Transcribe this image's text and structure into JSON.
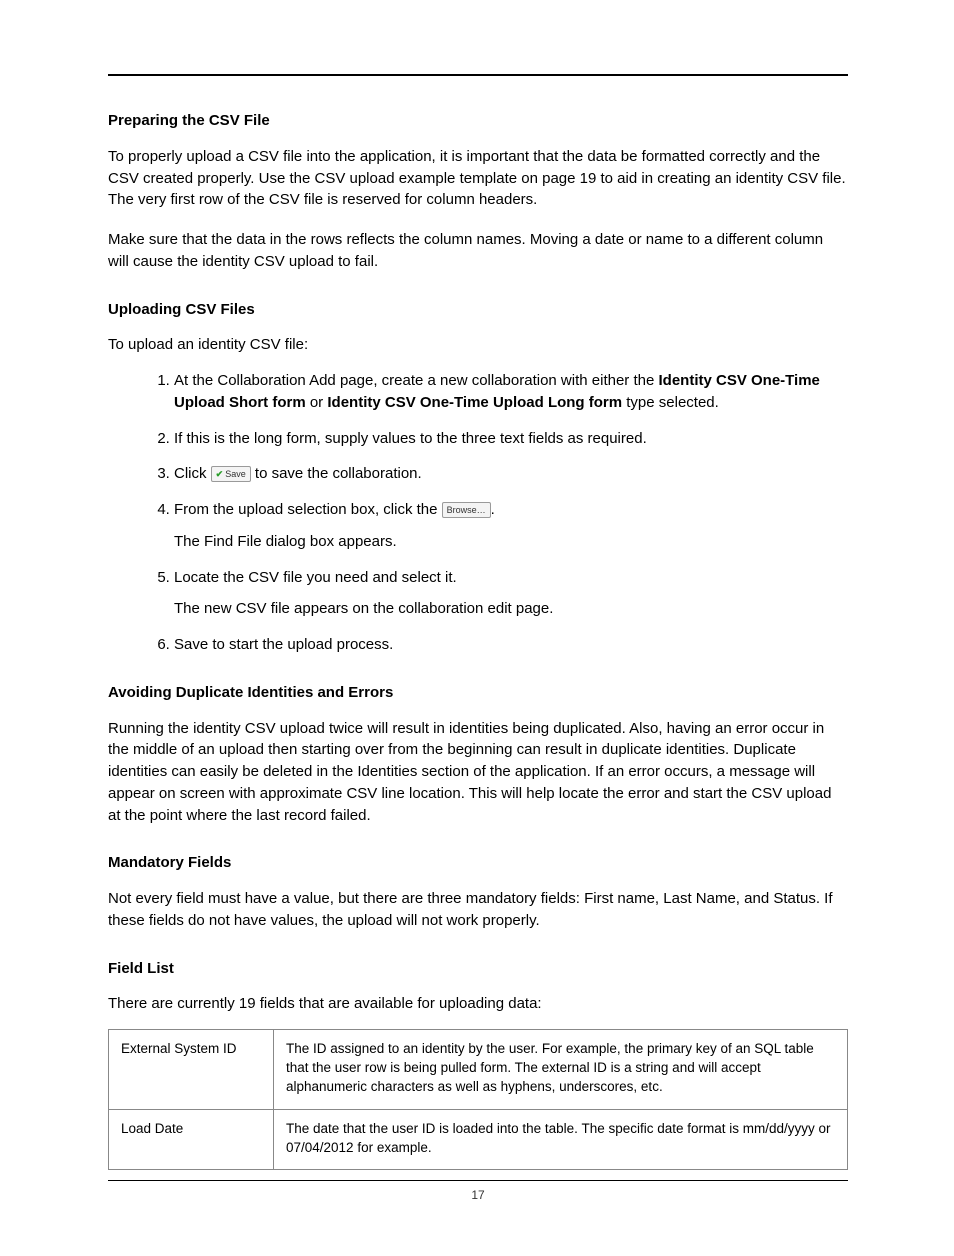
{
  "page_number": "17",
  "sections": {
    "preparing": {
      "heading": "Preparing the CSV File",
      "p1": "To properly upload a CSV file into the application, it is important that the data be formatted correctly and the CSV created properly. Use the CSV upload example template on page 19 to aid in creating an identity CSV file. The very first row of the CSV file is reserved for column headers.",
      "p2": "Make sure that the data in the rows reflects the column names. Moving a date or name to a different column will cause the identity CSV upload to fail."
    },
    "uploading": {
      "heading": "Uploading CSV Files",
      "lead": "To upload an identity CSV file:",
      "steps": {
        "s1_a": "At the Collaboration Add page, create a new collaboration with either the ",
        "s1_bold1": "Identity CSV One-Time Upload Short form",
        "s1_b": " or ",
        "s1_bold2": "Identity CSV One-Time Upload Long form",
        "s1_c": " type selected.",
        "s2": "If this is the long form, supply values to the three text fields as required.",
        "s3_a": "Click ",
        "s3_save_label": "Save",
        "s3_b": " to save the collaboration.",
        "s4_a": "From the upload selection box, click the ",
        "s4_browse_label": "Browse…",
        "s4_b": ".",
        "s4_sub": "The Find File dialog box appears.",
        "s5": "Locate the CSV file you need and select it.",
        "s5_sub": "The new CSV file appears on the collaboration edit page.",
        "s6": "Save to start the upload process."
      }
    },
    "avoiding": {
      "heading": "Avoiding Duplicate Identities and Errors",
      "p1": "Running the identity CSV upload twice will result in identities being duplicated. Also, having an error occur in the middle of an upload then starting over from the beginning can result in duplicate identities. Duplicate identities can easily be deleted in the Identities section of the application. If an error occurs, a message will appear on screen with approximate CSV line location. This will help locate the error and start the CSV upload at the point where the last record failed."
    },
    "mandatory": {
      "heading": "Mandatory Fields",
      "p1": "Not every field must have a value, but there are three mandatory fields: First name, Last Name, and Status. If these fields do not have values, the upload will not work properly."
    },
    "fieldlist": {
      "heading": "Field List",
      "lead": "There are currently 19 fields that are available for uploading data:",
      "rows": [
        {
          "name": "External System ID",
          "desc": "The ID assigned to an identity by the user. For example, the primary key of an SQL table that the user row is being pulled form. The external ID is a string and will accept alphanumeric characters as well as hyphens, underscores, etc."
        },
        {
          "name": "Load Date",
          "desc": "The date that the user ID is loaded into the table. The specific date format is mm/dd/yyyy or 07/04/2012 for example."
        }
      ]
    }
  }
}
